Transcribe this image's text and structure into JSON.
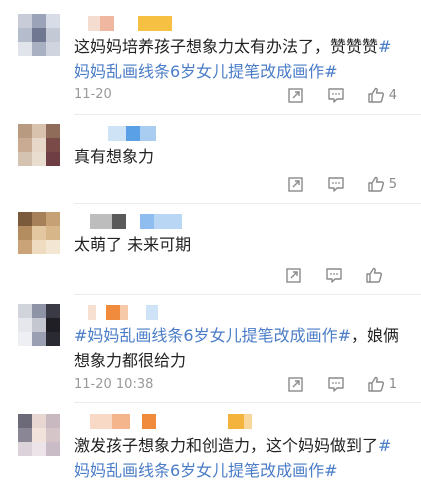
{
  "comments": [
    {
      "text_parts": [
        {
          "text": "这妈妈培养孩子想象力太有办法了，赞赞赞",
          "tag": false
        },
        {
          "text": "#妈妈乱画线条6岁女儿提笔改成画作#",
          "tag": true
        }
      ],
      "time": "11-20",
      "likes": "4"
    },
    {
      "text_parts": [
        {
          "text": "真有想象力",
          "tag": false
        }
      ],
      "time": "",
      "likes": "5"
    },
    {
      "text_parts": [
        {
          "text": "太萌了 未来可期",
          "tag": false
        }
      ],
      "time": "",
      "likes": ""
    },
    {
      "text_parts": [
        {
          "text": "#妈妈乱画线条6岁女儿提笔改成画作#",
          "tag": true
        },
        {
          "text": "，娘俩想象力都很给力",
          "tag": false
        }
      ],
      "time": "11-20 10:38",
      "likes": "1"
    },
    {
      "text_parts": [
        {
          "text": "激发孩子想象力和创造力，这个妈妈做到了",
          "tag": false
        },
        {
          "text": "#妈妈乱画线条6岁女儿提笔改成画作#",
          "tag": true
        }
      ],
      "time": "",
      "likes": ""
    }
  ],
  "icons": {
    "repost": "repost-icon",
    "comment": "comment-icon",
    "like": "thumbs-up-icon"
  },
  "colors": {
    "hashtag": "#4a7cc7",
    "meta": "#9a9a9a",
    "icon": "#8a8a8a"
  }
}
